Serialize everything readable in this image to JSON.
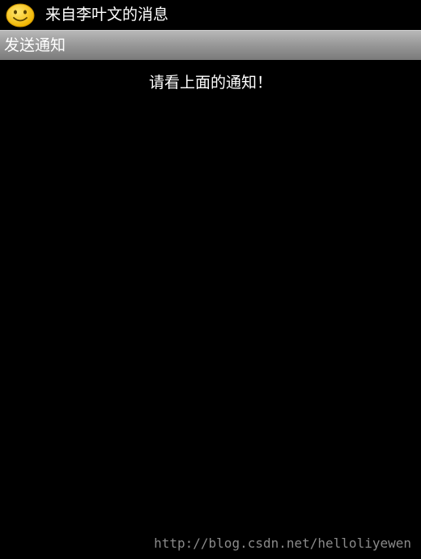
{
  "status_bar": {
    "notification_icon": "smiley-icon",
    "notification_title": "来自李叶文的消息"
  },
  "title_bar": {
    "title": "发送通知"
  },
  "main": {
    "message": "请看上面的通知！"
  },
  "watermark": {
    "text": "http://blog.csdn.net/helloliyewen"
  },
  "colors": {
    "background": "#000000",
    "title_bar": "#9a9a9a",
    "smiley_face": "#f6c400",
    "text": "#ffffff",
    "watermark": "#8a8a8a"
  }
}
